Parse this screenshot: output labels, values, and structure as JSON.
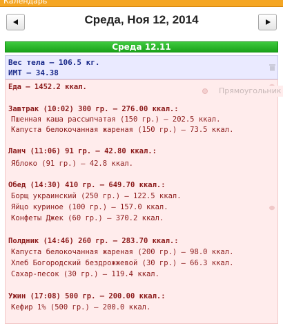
{
  "calendar_header": {
    "label": "Календарь"
  },
  "nav": {
    "prev_symbol": "◄",
    "next_symbol": "►",
    "date_title": "Среда, Ноя 12, 2014"
  },
  "day_bar": {
    "label": "Среда 12.11"
  },
  "body_stats": {
    "weight": "Вес тела — 106.5 кг.",
    "bmi": "ИМТ — 34.38"
  },
  "food": {
    "total": "Еда — 1452.2 ккал.",
    "meals": [
      {
        "title": "Завтрак (10:02) 300 гр. — 276.00 ккал.:",
        "items": [
          "Пшенная каша рассыпчатая (150 гр.) — 202.5 ккал.",
          "Капуста белокочанная жареная (150 гр.) — 73.5 ккал."
        ]
      },
      {
        "title": "Ланч (11:06) 91 гр. — 42.80 ккал.:",
        "items": [
          "Яблоко (91 гр.) — 42.8 ккал."
        ]
      },
      {
        "title": "Обед (14:30) 410 гр. — 649.70 ккал.:",
        "items": [
          "Борщ украинский (250 гр.) — 122.5 ккал.",
          "Яйцо куриное (100 гр.) — 157.0 ккал.",
          "Конфеты Джек (60 гр.) — 370.2 ккал."
        ]
      },
      {
        "title": "Полдник (14:46) 260 гр. — 283.70 ккал.:",
        "items": [
          "Капуста белокочанная жареная (200 гр.) — 98.0 ккал.",
          "Хлеб Богородский бездрожжевой (30 гр.) — 66.3 ккал.",
          "Сахар-песок (30 гр.) — 119.4 ккал."
        ]
      },
      {
        "title": "Ужин (17:08) 500 гр. — 200.00 ккал.:",
        "items": [
          "Кефир 1% (500 гр.) — 200.0 ккал."
        ]
      }
    ]
  },
  "popup": {
    "label": "Прямоугольник"
  },
  "colors": {
    "header_orange": "#f5a623",
    "day_green": "#22b022",
    "body_bg": "#eaeaff",
    "food_bg": "#ffecec",
    "food_text": "#8b1a1a"
  },
  "icons": {
    "prev": "left-triangle-icon",
    "next": "right-triangle-icon",
    "bin": "trash-icon",
    "pin": "pin-icon"
  }
}
